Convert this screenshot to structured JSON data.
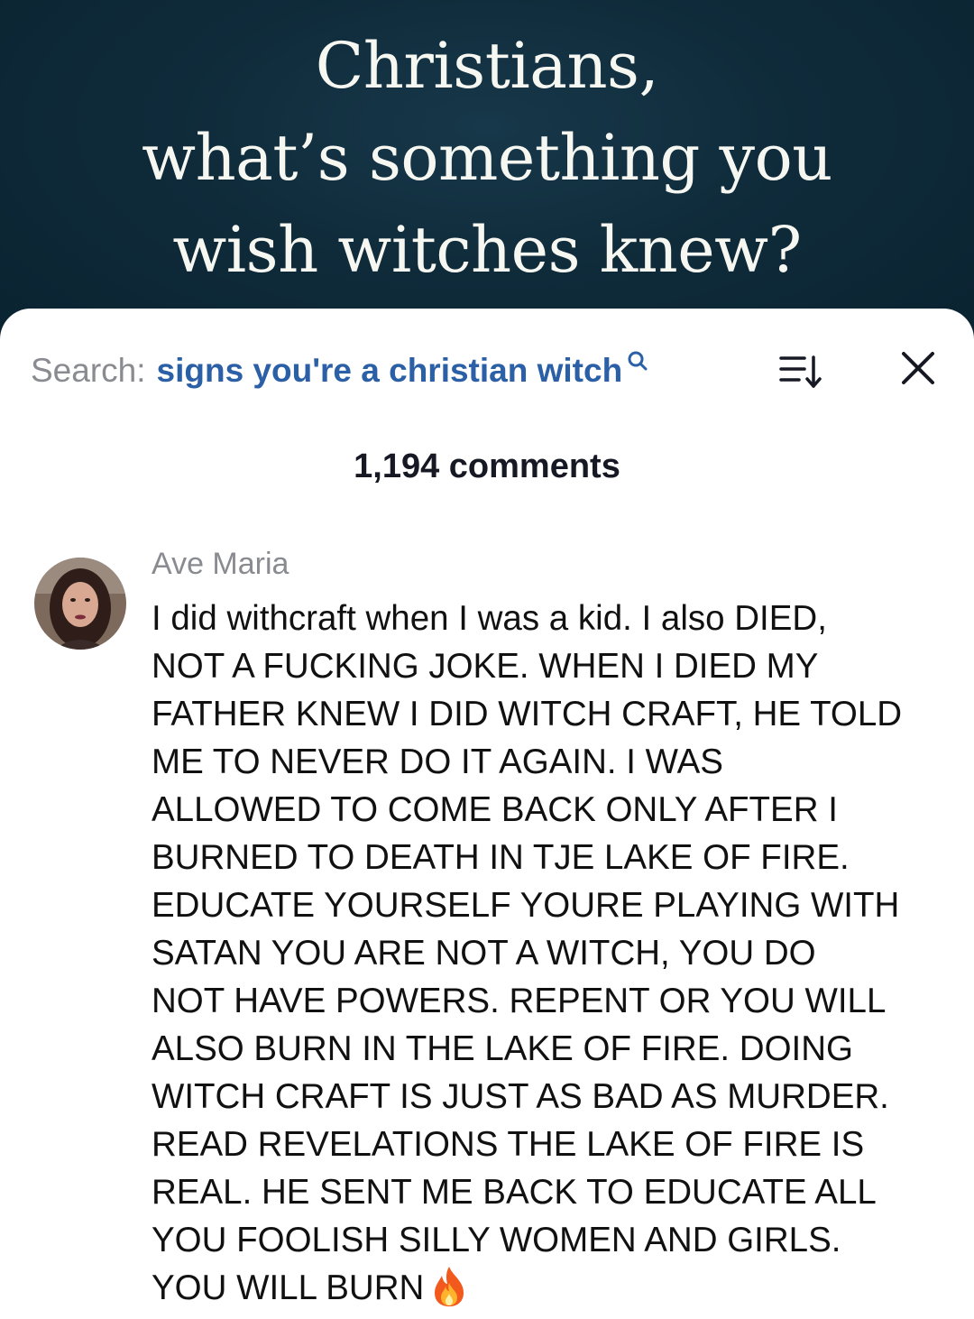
{
  "video": {
    "caption_lines": [
      "Christians,",
      "what’s something you",
      "wish witches knew?"
    ]
  },
  "comments_panel": {
    "search_prefix": "Search:",
    "search_query": "signs you're a christian witch",
    "search_icon": "search-icon",
    "sort_icon": "sort-icon",
    "close_icon": "close-icon",
    "comment_count": "1,194 comments"
  },
  "comment": {
    "author": "Ave Maria",
    "emoji": "fire-icon",
    "lines": [
      "I did withcraft when I was a kid. I also DIED,",
      "NOT A FUCKING JOKE. WHEN I DIED MY",
      "FATHER KNEW I DID WITCH CRAFT, HE TOLD",
      "ME TO NEVER DO IT AGAIN. I WAS",
      "ALLOWED TO COME BACK ONLY AFTER I",
      "BURNED TO DEATH IN TJE LAKE OF FIRE.",
      "EDUCATE YOURSELF YOURE PLAYING WITH",
      "SATAN YOU ARE NOT A WITCH, YOU DO",
      "NOT HAVE POWERS. REPENT OR YOU WILL",
      "ALSO BURN IN THE LAKE OF FIRE. DOING",
      "WITCH CRAFT IS JUST AS BAD AS MURDER.",
      "READ REVELATIONS THE LAKE OF FIRE IS",
      "REAL. HE SENT ME BACK TO EDUCATE ALL",
      "YOU FOOLISH SILLY WOMEN AND GIRLS.",
      "YOU WILL BURN"
    ]
  },
  "colors": {
    "video_bg": "#0f2b3a",
    "search_query": "#2b5fa6",
    "muted_text": "#8a8b91",
    "body_text": "#111111"
  }
}
